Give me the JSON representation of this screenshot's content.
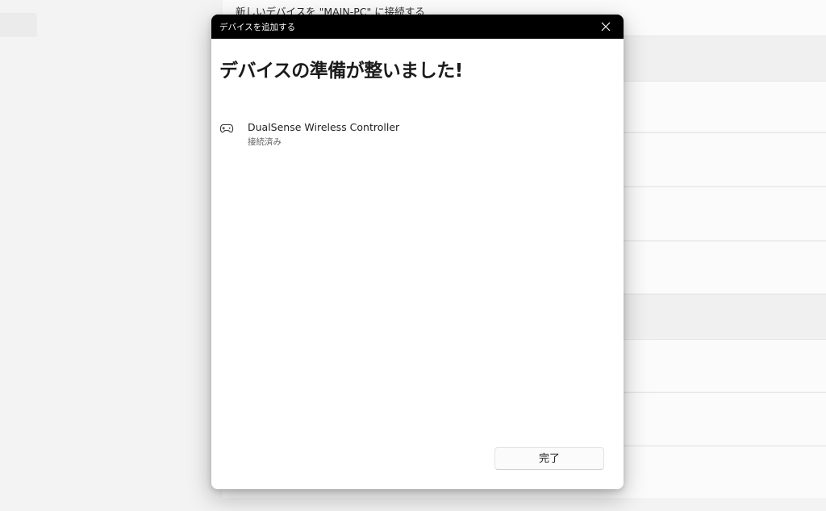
{
  "background": {
    "header_text": "新しいデバイスを \"MAIN-PC\" に接続する"
  },
  "dialog": {
    "title": "デバイスを追加する",
    "heading": "デバイスの準備が整いました!",
    "device": {
      "name": "DualSense Wireless Controller",
      "status": "接続済み",
      "icon": "gamepad-icon"
    },
    "done_label": "完了",
    "close_icon": "close-icon"
  }
}
